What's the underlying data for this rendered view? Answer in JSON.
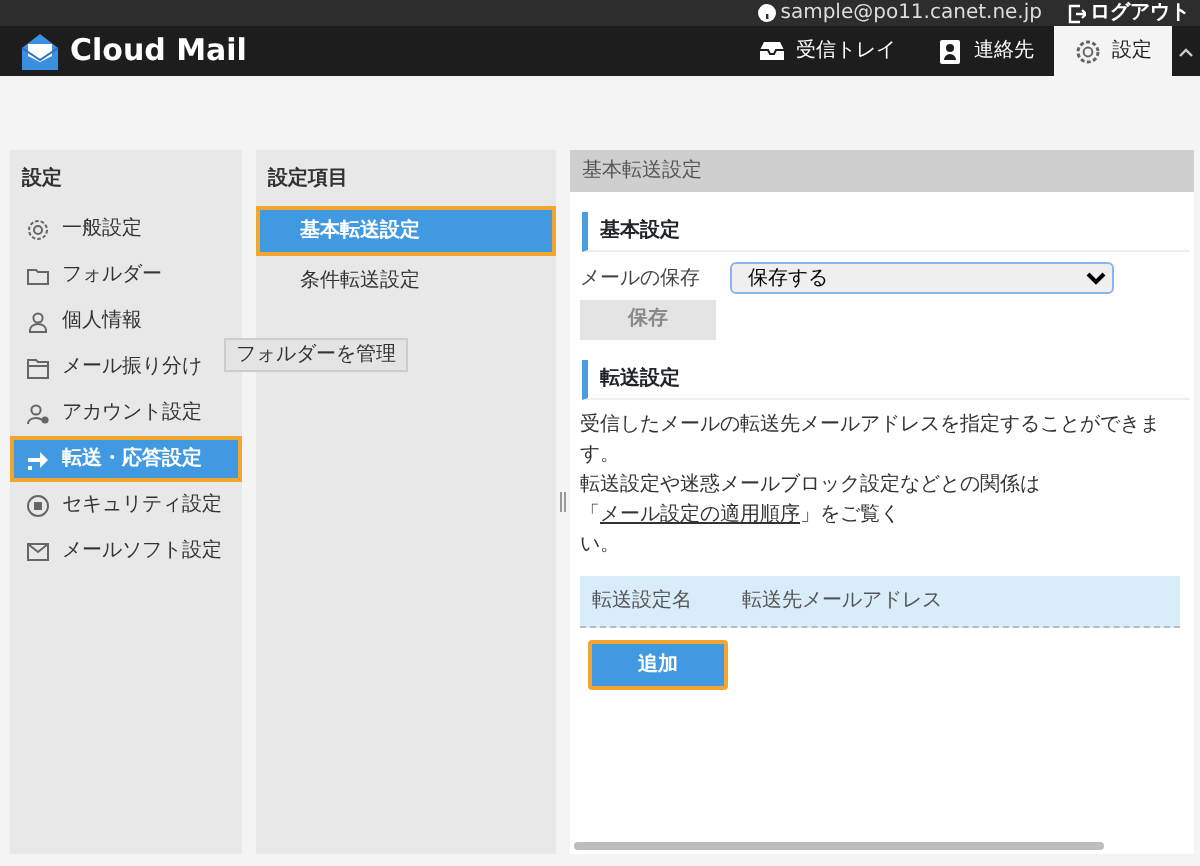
{
  "account_bar": {
    "email": "sample@po11.canet.ne.jp",
    "logout": "ログアウト"
  },
  "app": {
    "title": "Cloud Mail"
  },
  "nav": [
    {
      "label": "受信トレイ",
      "selected": false
    },
    {
      "label": "連絡先",
      "selected": false
    },
    {
      "label": "設定",
      "selected": true
    }
  ],
  "sidebar": {
    "heading": "設定",
    "items": [
      {
        "label": "一般設定",
        "selected": false,
        "highlighted": false
      },
      {
        "label": "フォルダー",
        "selected": false,
        "highlighted": false
      },
      {
        "label": "個人情報",
        "selected": false,
        "highlighted": false
      },
      {
        "label": "メール振り分け",
        "selected": false,
        "highlighted": false
      },
      {
        "label": "アカウント設定",
        "selected": false,
        "highlighted": false
      },
      {
        "label": "転送・応答設定",
        "selected": true,
        "highlighted": true
      },
      {
        "label": "セキュリティ設定",
        "selected": false,
        "highlighted": false
      },
      {
        "label": "メールソフト設定",
        "selected": false,
        "highlighted": false
      }
    ]
  },
  "tooltip": "フォルダーを管理",
  "submenu": {
    "heading": "設定項目",
    "items": [
      {
        "label": "基本転送設定",
        "selected": true,
        "highlighted": true
      },
      {
        "label": "条件転送設定",
        "selected": false,
        "highlighted": false
      }
    ]
  },
  "panel": {
    "title": "基本転送設定",
    "basic": {
      "heading": "基本設定",
      "field_label": "メールの保存",
      "select_value": "保存する",
      "save_button": "保存",
      "save_disabled": true
    },
    "forwarding": {
      "heading": "転送設定",
      "line1": "受信したメールの転送先メールアドレスを指定することができます。",
      "line2_before": "転送設定や迷惑メールブロック設定などとの関係は「",
      "link": "メール設定の適用順序",
      "line2_after": "」をご覧く",
      "line3": "い。",
      "table": {
        "columns": [
          "転送設定名",
          "転送先メールアドレス"
        ]
      },
      "add_button": "追加",
      "add_highlighted": true
    }
  }
}
